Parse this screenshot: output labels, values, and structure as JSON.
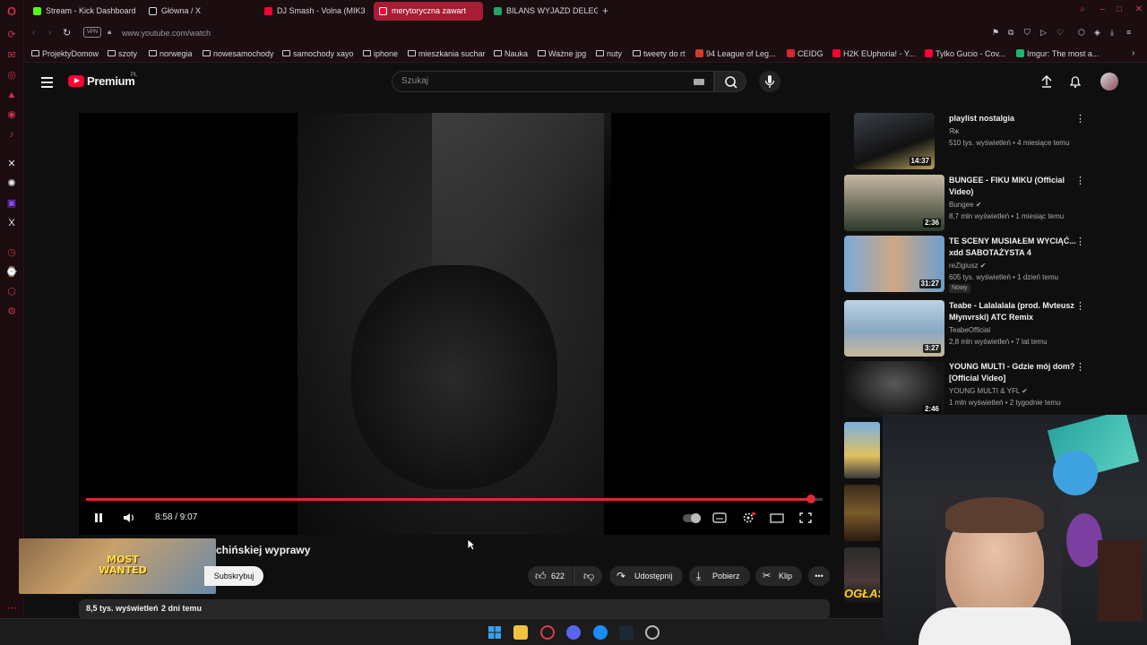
{
  "colors": {
    "brand": "#ff0033",
    "opera": "#c7334a",
    "accent": "#e3253a"
  },
  "browser": {
    "tabs": [
      {
        "label": "Stream - Kick Dashboard",
        "icon": "kick-icon",
        "color": "#53fc18"
      },
      {
        "label": "Główna / X",
        "icon": "x-icon",
        "color": "#ffffff"
      },
      {
        "label": "DJ Smash - Volna (MIK3",
        "icon": "youtube-icon",
        "color": "#ff0033"
      },
      {
        "label": "merytoryczna zawart",
        "icon": "youtube-icon",
        "color": "#ff0033"
      },
      {
        "label": "BILANS WYJAZD DELEGA",
        "icon": "sheets-icon",
        "color": "#23a566"
      }
    ],
    "new_tab": "+",
    "vpn_label": "VPN",
    "url": "www.youtube.com/watch",
    "bookmarks": [
      {
        "label": "ProjektyDomow",
        "type": "folder"
      },
      {
        "label": "szoty",
        "type": "folder"
      },
      {
        "label": "norwegia",
        "type": "folder"
      },
      {
        "label": "nowesamochody",
        "type": "folder"
      },
      {
        "label": "samochody xayo",
        "type": "folder"
      },
      {
        "label": "iphone",
        "type": "folder"
      },
      {
        "label": "mieszkania suchar",
        "type": "folder"
      },
      {
        "label": "Nauka",
        "type": "folder"
      },
      {
        "label": "Ważne jpg",
        "type": "folder"
      },
      {
        "label": "nuty",
        "type": "folder"
      },
      {
        "label": "tweety do rt",
        "type": "folder"
      },
      {
        "label": "94 League of Leg...",
        "type": "site",
        "color": "#d13b2a"
      },
      {
        "label": "CEIDG",
        "type": "site",
        "color": "#d8262f"
      },
      {
        "label": "H2K EUphoria! - Y...",
        "type": "site",
        "color": "#ff0033"
      },
      {
        "label": "Tylko Gucio - Cov...",
        "type": "site",
        "color": "#ff0033"
      },
      {
        "label": "Imgur: The most a...",
        "type": "site",
        "color": "#1bb76e"
      }
    ]
  },
  "youtube": {
    "logo_text": "Premium",
    "logo_badge": "PL",
    "search_placeholder": "Szukaj",
    "player": {
      "time": "8:58 / 9:07",
      "progress": 0.984
    },
    "video_title": "chińskiej wyprawy",
    "subscribe_label": "Subskrybuj",
    "likes": "622",
    "share_label": "Udostępnij",
    "download_label": "Pobierz",
    "clip_label": "Klip",
    "views": "8,5 tys. wyświetleń",
    "date": "2 dni temu",
    "mini_thumb_text": "MOST WANTED",
    "recommendations": [
      {
        "title": "playlist nostalgia",
        "channel": "Яж",
        "meta": "510 tys. wyświetleń • 4 miesiące temu",
        "duration": "14:37",
        "verified": false,
        "badge": ""
      },
      {
        "title": "BUNGEE - FIKU MIKU (Official Video)",
        "channel": "Bungee",
        "meta": "8,7 mln wyświetleń • 1 miesiąc temu",
        "duration": "2:36",
        "verified": true,
        "badge": ""
      },
      {
        "title": "TE SCENY MUSIAŁEM WYCIĄĆ... xdd SABOTAŻYSTA 4",
        "channel": "reZigiusz",
        "meta": "605 tys. wyświetleń • 1 dzień temu",
        "duration": "31:27",
        "verified": true,
        "badge": "Nowy"
      },
      {
        "title": "Teabe - Lalalalala (prod. Mvteusz Młynvrski) ATC Remix",
        "channel": "TeabeOfficial",
        "meta": "2,8 mln wyświetleń • 7 lat temu",
        "duration": "3:27",
        "verified": false,
        "badge": ""
      },
      {
        "title": "YOUNG MULTI - Gdzie mój dom? [Official Video]",
        "channel": "YOUNG MULTI & YFL",
        "meta": "1 mln wyświetleń • 2 tygodnie temu",
        "duration": "2:46",
        "verified": true,
        "badge": ""
      }
    ],
    "overlay_text": "OGŁAS"
  }
}
